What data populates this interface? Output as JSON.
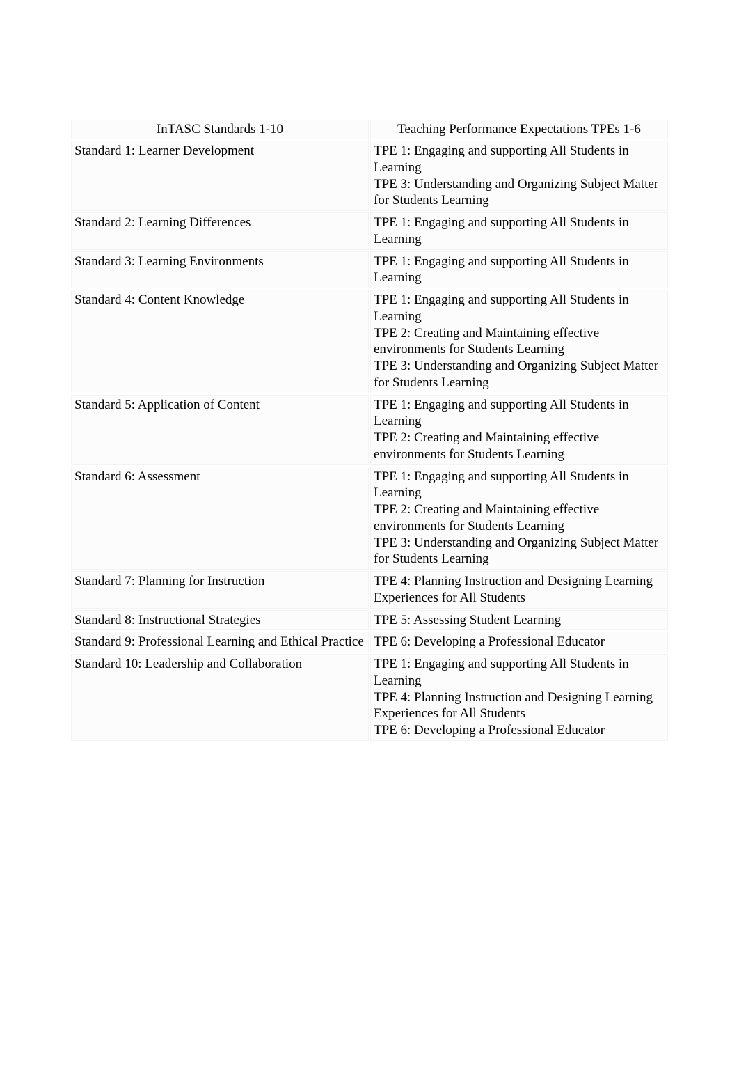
{
  "table": {
    "headers": {
      "left": "InTASC Standards 1-10",
      "right": "Teaching Performance Expectations TPEs 1-6"
    },
    "rows": [
      {
        "standard": "Standard 1: Learner Development",
        "tpes": [
          "TPE 1: Engaging and supporting All Students in Learning",
          "TPE 3: Understanding and Organizing Subject Matter for Students Learning"
        ]
      },
      {
        "standard": "Standard 2: Learning Differences",
        "tpes": [
          "TPE 1: Engaging and supporting All Students in Learning"
        ]
      },
      {
        "standard": "Standard 3: Learning Environments",
        "tpes": [
          "TPE 1: Engaging and supporting All Students in Learning"
        ]
      },
      {
        "standard": "Standard 4: Content Knowledge",
        "tpes": [
          "TPE 1: Engaging and supporting All Students in Learning",
          "TPE 2: Creating and Maintaining effective environments for Students Learning",
          "TPE 3: Understanding and Organizing Subject Matter for Students Learning"
        ]
      },
      {
        "standard": "Standard 5: Application of Content",
        "tpes": [
          "TPE 1: Engaging and supporting All Students in Learning",
          "TPE 2: Creating and Maintaining effective environments for Students Learning"
        ]
      },
      {
        "standard": "Standard 6: Assessment",
        "tpes": [
          "TPE 1: Engaging and supporting All Students in Learning",
          "TPE 2: Creating and Maintaining effective environments for Students Learning",
          "TPE 3: Understanding and Organizing Subject Matter for Students Learning"
        ]
      },
      {
        "standard": "Standard 7: Planning for Instruction",
        "tpes": [
          "TPE 4: Planning Instruction and Designing Learning Experiences for All Students"
        ]
      },
      {
        "standard": "Standard 8: Instructional Strategies",
        "tpes": [
          "TPE 5: Assessing Student Learning"
        ]
      },
      {
        "standard": "Standard 9: Professional Learning and Ethical Practice",
        "tpes": [
          "TPE 6: Developing a Professional Educator"
        ]
      },
      {
        "standard": "Standard 10: Leadership and Collaboration",
        "tpes": [
          "TPE 1: Engaging and supporting All Students in Learning",
          "TPE 4: Planning Instruction and Designing Learning Experiences for All Students",
          "TPE 6: Developing a Professional Educator"
        ]
      }
    ]
  }
}
